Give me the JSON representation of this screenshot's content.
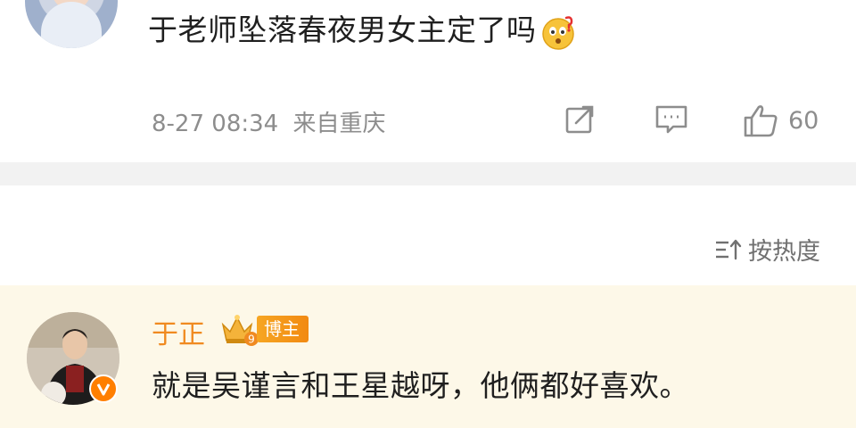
{
  "post": {
    "text": "于老师坠落春夜男女主定了吗",
    "emoji": "thinking-question-emoji",
    "timestamp": "8-27 08:34",
    "location": "来自重庆",
    "like_count": "60"
  },
  "sort": {
    "label": "按热度",
    "icon": "sort-icon"
  },
  "reply": {
    "username": "于正",
    "badge": "博主",
    "crown_level": "9",
    "text": "就是吴谨言和王星越呀，他俩都好喜欢。"
  },
  "colors": {
    "accent_orange": "#f08a20",
    "pinned_bg": "#fdf8e8",
    "divider": "#f2f2f2",
    "muted_text": "#8d8d8d"
  }
}
